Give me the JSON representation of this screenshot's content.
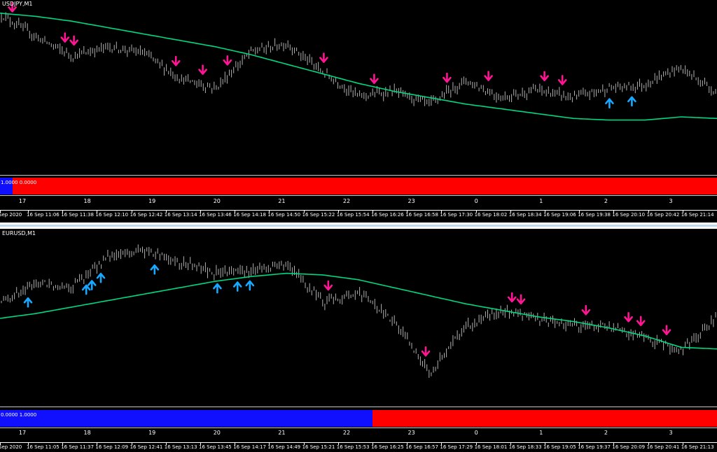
{
  "colors": {
    "background": "#000000",
    "candle": "#b0b0b0",
    "ma": "#00d880",
    "up_arrow": "#19a8ff",
    "down_arrow": "#ff1493",
    "ind_blue": "#1010ff",
    "ind_red": "#ff0000"
  },
  "panels": [
    {
      "symbol": "USDJPY,M1",
      "indicator_label": "1.0000 0.0000",
      "indicator_blue_fraction": 0.018,
      "hour_labels": [
        "17",
        "18",
        "19",
        "20",
        "21",
        "22",
        "23",
        "0",
        "1",
        "2",
        "3"
      ],
      "time_labels": [
        "Sep 2020",
        "16 Sep 11:06",
        "16 Sep 11:38",
        "16 Sep 12:10",
        "16 Sep 12:42",
        "16 Sep 13:14",
        "16 Sep 13:46",
        "16 Sep 14:18",
        "16 Sep 14:50",
        "16 Sep 15:22",
        "16 Sep 15:54",
        "16 Sep 16:26",
        "16 Sep 16:58",
        "16 Sep 17:30",
        "16 Sep 18:02",
        "16 Sep 18:34",
        "16 Sep 19:06",
        "16 Sep 19:38",
        "16 Sep 20:10",
        "16 Sep 20:42",
        "16 Sep 21:14"
      ]
    },
    {
      "symbol": "EURUSD,M1",
      "indicator_label": "0.0000 1.0000",
      "indicator_blue_fraction": 0.52,
      "hour_labels": [
        "17",
        "18",
        "19",
        "20",
        "21",
        "22",
        "23",
        "0",
        "1",
        "2",
        "3"
      ],
      "time_labels": [
        "Sep 2020",
        "16 Sep 11:05",
        "16 Sep 11:37",
        "16 Sep 12:09",
        "16 Sep 12:41",
        "16 Sep 13:13",
        "16 Sep 13:45",
        "16 Sep 14:17",
        "16 Sep 14:49",
        "16 Sep 15:21",
        "16 Sep 15:53",
        "16 Sep 16:25",
        "16 Sep 16:57",
        "16 Sep 17:29",
        "16 Sep 18:01",
        "16 Sep 18:33",
        "16 Sep 19:05",
        "16 Sep 19:37",
        "16 Sep 20:09",
        "16 Sep 20:41",
        "16 Sep 21:13"
      ]
    }
  ],
  "chart_data": [
    {
      "type": "line",
      "title": "USDJPY,M1",
      "x": [
        "16 Sep 11:06",
        "16 Sep 11:38",
        "16 Sep 12:10",
        "16 Sep 12:42",
        "16 Sep 13:14",
        "16 Sep 13:46",
        "16 Sep 14:18",
        "16 Sep 14:50",
        "16 Sep 15:22",
        "16 Sep 15:54",
        "16 Sep 16:26",
        "16 Sep 16:58",
        "16 Sep 17:30",
        "16 Sep 18:02",
        "16 Sep 18:34",
        "16 Sep 19:06",
        "16 Sep 19:38",
        "16 Sep 20:10",
        "16 Sep 20:42",
        "16 Sep 21:14"
      ],
      "series": [
        {
          "values": [
            96,
            82,
            70,
            76,
            72,
            56,
            50,
            73,
            78,
            60,
            45,
            48,
            40,
            55,
            44,
            49,
            44,
            50,
            52,
            63,
            48
          ]
        },
        {
          "values": [
            97,
            95,
            92,
            88,
            84,
            80,
            76,
            71,
            65,
            59,
            53,
            48,
            44,
            40,
            37,
            34,
            31,
            30,
            30,
            32,
            31
          ]
        }
      ],
      "down_arrows_at": [
        "16 Sep 11:17",
        "16 Sep 12:04",
        "16 Sep 12:12",
        "16 Sep 13:43",
        "16 Sep 14:07",
        "16 Sep 14:29",
        "16 Sep 15:55",
        "16 Sep 16:40",
        "16 Sep 17:45",
        "16 Sep 18:22",
        "16 Sep 19:12",
        "16 Sep 19:28"
      ],
      "up_arrows_at": [
        "16 Sep 20:10",
        "16 Sep 20:30"
      ],
      "ylim": [
        0,
        100
      ],
      "grid": false
    },
    {
      "type": "line",
      "title": "EURUSD,M1",
      "x": [
        "16 Sep 11:05",
        "16 Sep 11:37",
        "16 Sep 12:09",
        "16 Sep 12:41",
        "16 Sep 13:13",
        "16 Sep 13:45",
        "16 Sep 14:17",
        "16 Sep 14:49",
        "16 Sep 15:21",
        "16 Sep 15:53",
        "16 Sep 16:25",
        "16 Sep 16:57",
        "16 Sep 17:29",
        "16 Sep 18:01",
        "16 Sep 18:33",
        "16 Sep 19:05",
        "16 Sep 19:37",
        "16 Sep 20:09",
        "16 Sep 20:41",
        "16 Sep 21:13"
      ],
      "series": [
        {
          "values": [
            60,
            72,
            70,
            88,
            92,
            85,
            78,
            80,
            84,
            60,
            66,
            48,
            16,
            45,
            55,
            50,
            46,
            45,
            38,
            30,
            50
          ]
        },
        {
          "values": [
            50,
            53,
            57,
            61,
            65,
            69,
            73,
            76,
            78,
            77,
            74,
            69,
            64,
            59,
            55,
            51,
            48,
            44,
            39,
            32,
            31
          ]
        }
      ],
      "down_arrows_at": [
        "16 Sep 15:58",
        "16 Sep 17:25",
        "16 Sep 18:42",
        "16 Sep 18:50",
        "16 Sep 19:48",
        "16 Sep 20:26",
        "16 Sep 20:37",
        "16 Sep 21:00"
      ],
      "up_arrows_at": [
        "16 Sep 11:30",
        "16 Sep 12:22",
        "16 Sep 12:27",
        "16 Sep 12:35",
        "16 Sep 13:23",
        "16 Sep 14:19",
        "16 Sep 14:37",
        "16 Sep 14:48"
      ],
      "ylim": [
        0,
        100
      ],
      "grid": false
    }
  ]
}
